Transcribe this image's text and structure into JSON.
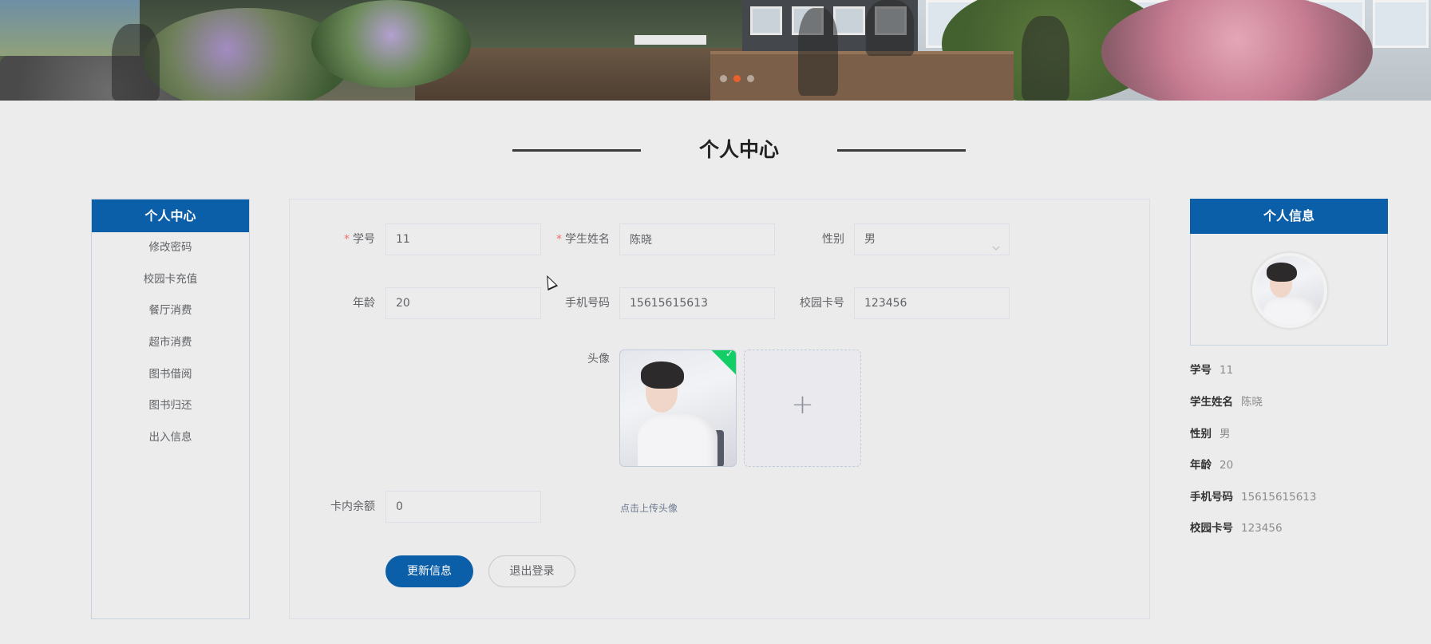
{
  "banner": {
    "slides": 3,
    "active_slide": 2
  },
  "section_title": "个人中心",
  "left_nav": {
    "title": "个人中心",
    "items": [
      "修改密码",
      "校园卡充值",
      "餐厅消费",
      "超市消费",
      "图书借阅",
      "图书归还",
      "出入信息"
    ]
  },
  "form": {
    "student_id": {
      "label": "学号",
      "value": "11",
      "required": true
    },
    "student_name": {
      "label": "学生姓名",
      "value": "陈晓",
      "required": true
    },
    "gender": {
      "label": "性别",
      "value": "男"
    },
    "age": {
      "label": "年龄",
      "value": "20"
    },
    "phone": {
      "label": "手机号码",
      "value": "15615615613"
    },
    "card_no": {
      "label": "校园卡号",
      "value": "123456"
    },
    "avatar": {
      "label": "头像",
      "upload_hint": "点击上传头像",
      "plus": "+"
    },
    "balance": {
      "label": "卡内余额",
      "value": "0"
    },
    "update_button": "更新信息",
    "logout_button": "退出登录",
    "required_mark": "*"
  },
  "right_panel": {
    "title": "个人信息",
    "rows": [
      {
        "key": "学号",
        "value": "11"
      },
      {
        "key": "学生姓名",
        "value": "陈晓"
      },
      {
        "key": "性别",
        "value": "男"
      },
      {
        "key": "年龄",
        "value": "20"
      },
      {
        "key": "手机号码",
        "value": "15615615613"
      },
      {
        "key": "校园卡号",
        "value": "123456"
      }
    ]
  },
  "colors": {
    "primary": "#0b5ea8",
    "required": "#f56c6c",
    "success": "#13ce66",
    "carousel_active": "#e8602c"
  },
  "icons": [
    "chevron-down-icon",
    "check-icon",
    "plus-icon",
    "cursor-icon"
  ]
}
